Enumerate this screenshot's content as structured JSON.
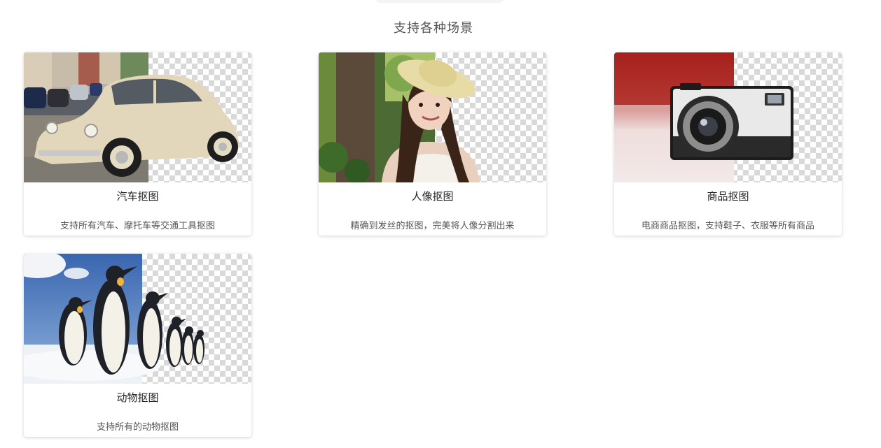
{
  "section": {
    "title": "支持各种场景"
  },
  "scenes": [
    {
      "name": "汽车抠图",
      "desc": "支持所有汽车、摩托车等交通工具抠图",
      "image": "car-cutout-image"
    },
    {
      "name": "人像抠图",
      "desc": "精确到发丝的抠图，完美将人像分割出来",
      "image": "portrait-cutout-image"
    },
    {
      "name": "商品抠图",
      "desc": "电商商品抠图，支持鞋子、衣服等所有商品",
      "image": "camera-cutout-image"
    },
    {
      "name": "动物抠图",
      "desc": "支持所有的动物抠图",
      "image": "penguin-cutout-image"
    }
  ]
}
